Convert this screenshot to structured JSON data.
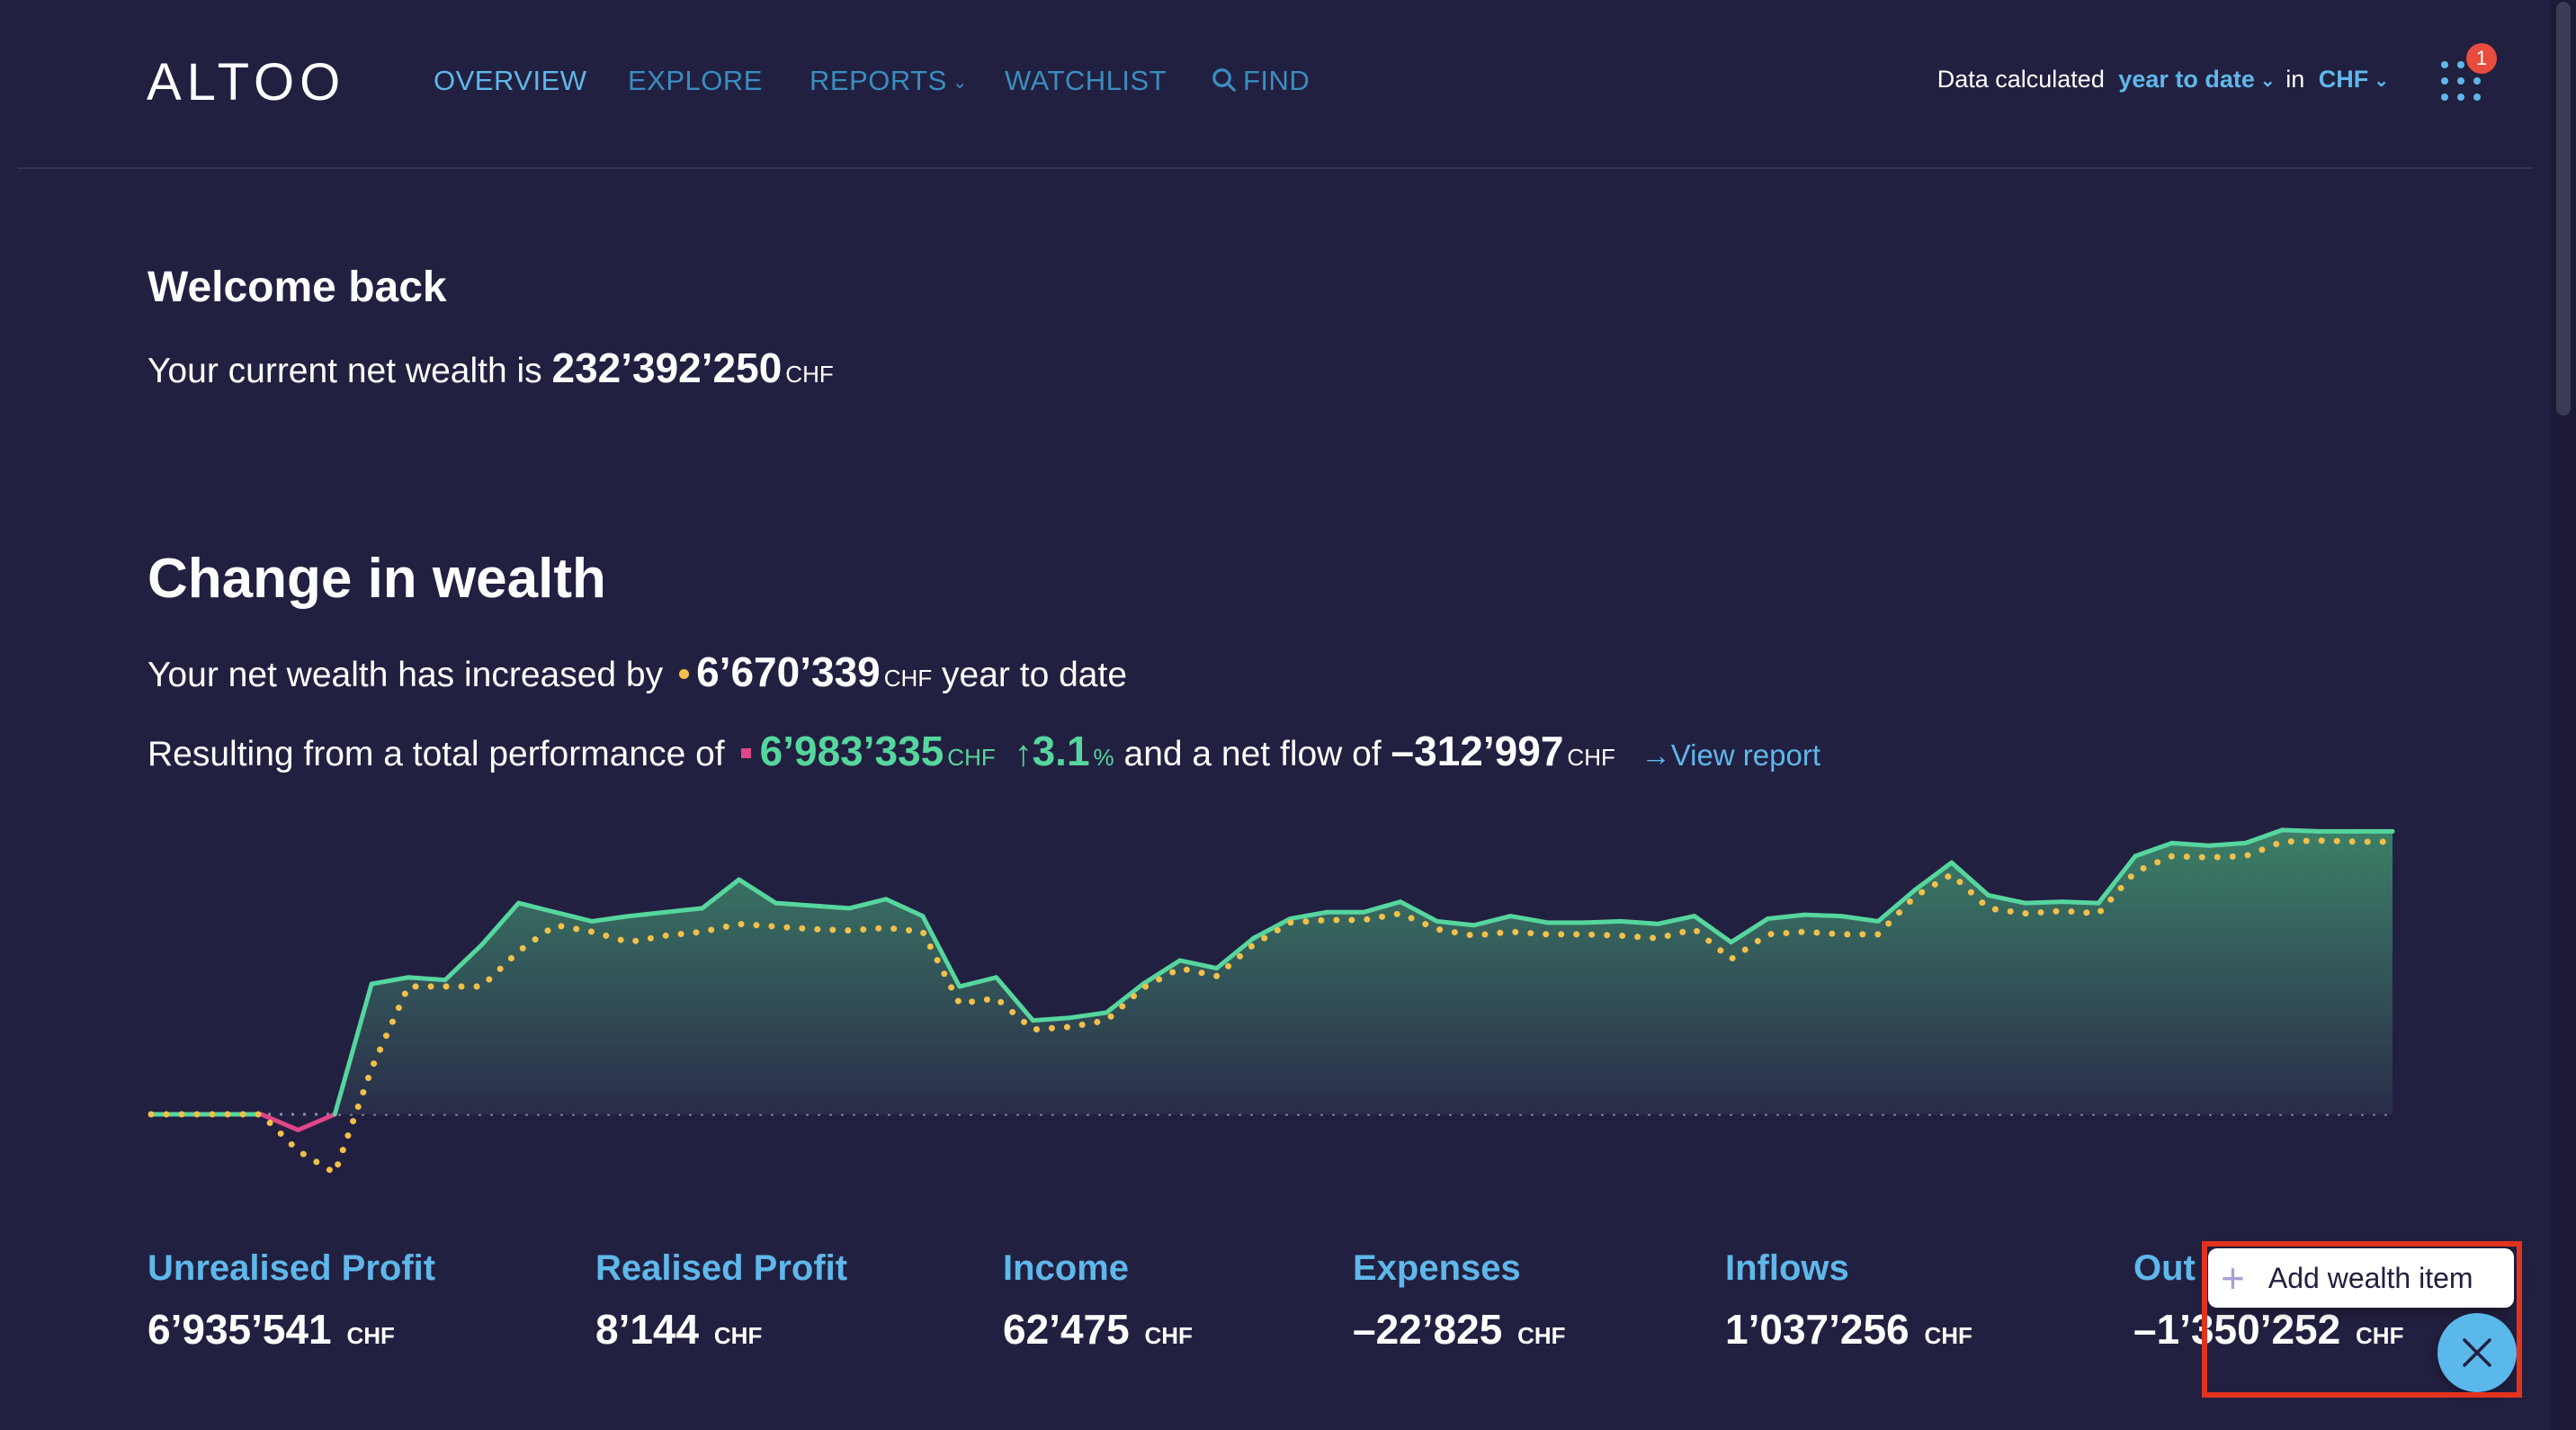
{
  "app": {
    "logo": "ALTOO"
  },
  "nav": [
    {
      "label": "OVERVIEW",
      "active": true
    },
    {
      "label": "EXPLORE"
    },
    {
      "label": "REPORTS"
    },
    {
      "label": "WATCHLIST"
    },
    {
      "label": "FIND"
    }
  ],
  "settings": {
    "prefix": "Data calculated",
    "period": "year to date",
    "mid": "in",
    "currency": "CHF"
  },
  "notifications": {
    "count": "1"
  },
  "welcome": {
    "title": "Welcome back",
    "text": "Your current net wealth is",
    "value": "232’392’250",
    "unit": "CHF"
  },
  "change": {
    "title": "Change in wealth",
    "increase_text": "Your net wealth has increased by",
    "increase_value": "6’670’339",
    "increase_unit": "CHF",
    "increase_suffix": "year to date",
    "perf_text": "Resulting from a total performance of",
    "perf_value": "6’983’335",
    "perf_unit": "CHF",
    "perf_pct": "3.1",
    "perf_pct_unit": "%",
    "flow_text": "and a net flow of",
    "flow_value": "–312’997",
    "flow_unit": "CHF",
    "view_report": "View report"
  },
  "stats": [
    {
      "label": "Unrealised Profit",
      "value": "6’935’541",
      "unit": "CHF"
    },
    {
      "label": "Realised Profit",
      "value": "8’144",
      "unit": "CHF"
    },
    {
      "label": "Income",
      "value": "62’475",
      "unit": "CHF"
    },
    {
      "label": "Expenses",
      "value": "–22’825",
      "unit": "CHF"
    },
    {
      "label": "Inflows",
      "value": "1’037’256",
      "unit": "CHF"
    },
    {
      "label": "Out",
      "value": "–1’350’252",
      "unit": "CHF"
    }
  ],
  "fab_menu": {
    "add_label": "Add wealth item"
  },
  "colors": {
    "accent": "#5fb7ea",
    "positive": "#56d69e",
    "negative": "#e0468a",
    "netflow": "#f2c04a",
    "background": "#222040"
  },
  "chart_data": {
    "type": "area",
    "title": "",
    "xlabel": "",
    "ylabel": "",
    "grid": false,
    "baseline": 0,
    "series": [
      {
        "values": [
          0,
          0,
          0,
          0,
          -0.12,
          0,
          1.0,
          1.05,
          1.03,
          1.3,
          1.62,
          1.55,
          1.48,
          1.52,
          1.55,
          1.58,
          1.8,
          1.62,
          1.6,
          1.58,
          1.65,
          1.52,
          0.98,
          1.05,
          0.72,
          0.74,
          0.78,
          1.0,
          1.18,
          1.12,
          1.35,
          1.5,
          1.55,
          1.55,
          1.63,
          1.48,
          1.45,
          1.52,
          1.47,
          1.47,
          1.48,
          1.46,
          1.52,
          1.32,
          1.5,
          1.53,
          1.52,
          1.48,
          1.72,
          1.93,
          1.68,
          1.62,
          1.63,
          1.62,
          1.98,
          2.08,
          2.06,
          2.08,
          2.18,
          2.17,
          2.17,
          2.17
        ]
      },
      {
        "values": [
          0,
          0,
          0,
          0,
          -0.28,
          -0.45,
          0.35,
          0.98,
          0.98,
          0.98,
          1.25,
          1.45,
          1.4,
          1.32,
          1.37,
          1.4,
          1.46,
          1.44,
          1.42,
          1.41,
          1.43,
          1.4,
          0.85,
          0.89,
          0.65,
          0.67,
          0.72,
          0.97,
          1.12,
          1.06,
          1.3,
          1.47,
          1.49,
          1.49,
          1.54,
          1.42,
          1.37,
          1.4,
          1.38,
          1.38,
          1.37,
          1.35,
          1.42,
          1.19,
          1.38,
          1.4,
          1.38,
          1.38,
          1.67,
          1.84,
          1.58,
          1.54,
          1.56,
          1.54,
          1.86,
          1.98,
          1.97,
          1.98,
          2.09,
          2.1,
          2.09,
          2.09
        ]
      }
    ]
  }
}
